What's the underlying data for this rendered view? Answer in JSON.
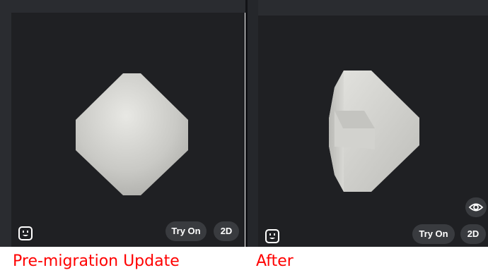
{
  "panels": {
    "left": {
      "caption": "Pre-migration Update",
      "try_on_label": "Try On",
      "view_2d_label": "2D"
    },
    "right": {
      "caption": "After",
      "try_on_label": "Try On",
      "view_2d_label": "2D"
    }
  },
  "colors": {
    "panel_bg": "#1f2023",
    "pill_bg": "#393b3f",
    "caption": "#ff0000",
    "model": "#d6d6d2"
  },
  "icons": {
    "avatar_face": "smiley-face-icon",
    "visibility": "eye-icon"
  }
}
